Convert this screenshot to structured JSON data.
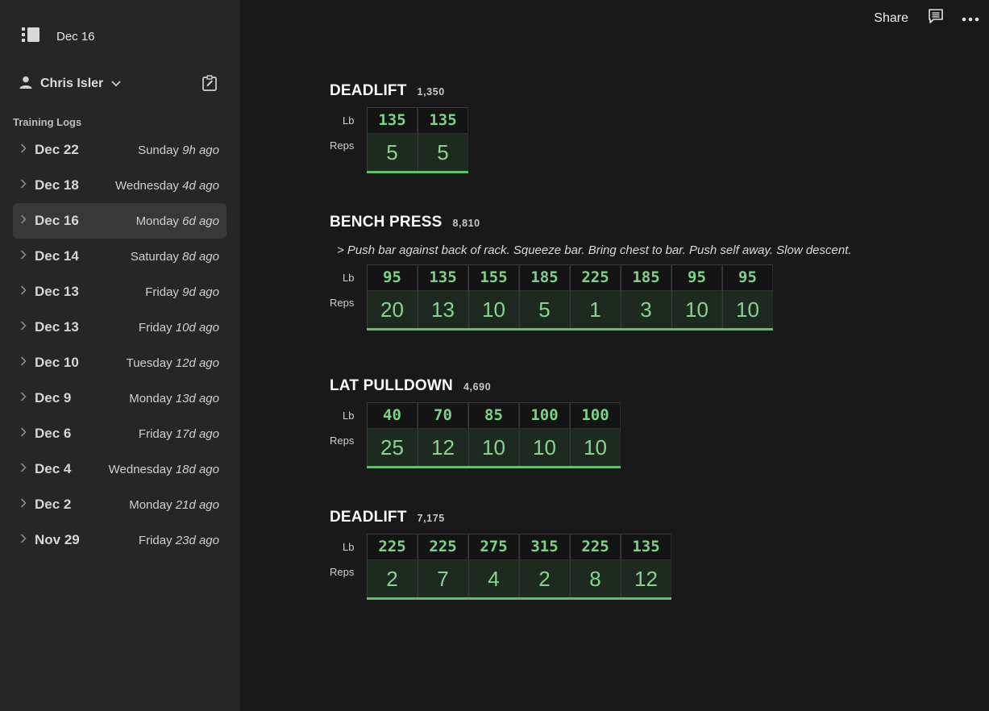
{
  "sidebar": {
    "current_date": "Dec 16",
    "user_name": "Chris Isler",
    "section_label": "Training Logs",
    "logs": [
      {
        "date": "Dec 22",
        "day": "Sunday",
        "ago": "9h ago"
      },
      {
        "date": "Dec 18",
        "day": "Wednesday",
        "ago": "4d ago"
      },
      {
        "date": "Dec 16",
        "day": "Monday",
        "ago": "6d ago",
        "active": true
      },
      {
        "date": "Dec 14",
        "day": "Saturday",
        "ago": "8d ago"
      },
      {
        "date": "Dec 13",
        "day": "Friday",
        "ago": "9d ago"
      },
      {
        "date": "Dec 13",
        "day": "Friday",
        "ago": "10d ago"
      },
      {
        "date": "Dec 10",
        "day": "Tuesday",
        "ago": "12d ago"
      },
      {
        "date": "Dec 9",
        "day": "Monday",
        "ago": "13d ago"
      },
      {
        "date": "Dec 6",
        "day": "Friday",
        "ago": "17d ago"
      },
      {
        "date": "Dec 4",
        "day": "Wednesday",
        "ago": "18d ago"
      },
      {
        "date": "Dec 2",
        "day": "Monday",
        "ago": "21d ago"
      },
      {
        "date": "Nov 29",
        "day": "Friday",
        "ago": "23d ago"
      }
    ]
  },
  "topbar": {
    "share_label": "Share"
  },
  "labels": {
    "weight": "Lb",
    "reps": "Reps"
  },
  "colors": {
    "accent": "#5fbf6a",
    "sidebar_bg": "#262626",
    "main_bg": "#191919"
  },
  "exercises": [
    {
      "name": "DEADLIFT",
      "total": "1,350",
      "note": "",
      "sets": [
        {
          "w": "135",
          "r": "5"
        },
        {
          "w": "135",
          "r": "5"
        }
      ]
    },
    {
      "name": "BENCH PRESS",
      "total": "8,810",
      "note": "> Push bar against back of rack. Squeeze bar. Bring chest to bar. Push self away. Slow descent.",
      "sets": [
        {
          "w": "95",
          "r": "20"
        },
        {
          "w": "135",
          "r": "13"
        },
        {
          "w": "155",
          "r": "10"
        },
        {
          "w": "185",
          "r": "5"
        },
        {
          "w": "225",
          "r": "1"
        },
        {
          "w": "185",
          "r": "3"
        },
        {
          "w": "95",
          "r": "10"
        },
        {
          "w": "95",
          "r": "10"
        }
      ]
    },
    {
      "name": "LAT PULLDOWN",
      "total": "4,690",
      "note": "",
      "sets": [
        {
          "w": "40",
          "r": "25"
        },
        {
          "w": "70",
          "r": "12"
        },
        {
          "w": "85",
          "r": "10"
        },
        {
          "w": "100",
          "r": "10"
        },
        {
          "w": "100",
          "r": "10"
        }
      ]
    },
    {
      "name": "DEADLIFT",
      "total": "7,175",
      "note": "",
      "sets": [
        {
          "w": "225",
          "r": "2"
        },
        {
          "w": "225",
          "r": "7"
        },
        {
          "w": "275",
          "r": "4"
        },
        {
          "w": "315",
          "r": "2"
        },
        {
          "w": "225",
          "r": "8"
        },
        {
          "w": "135",
          "r": "12"
        }
      ]
    }
  ]
}
